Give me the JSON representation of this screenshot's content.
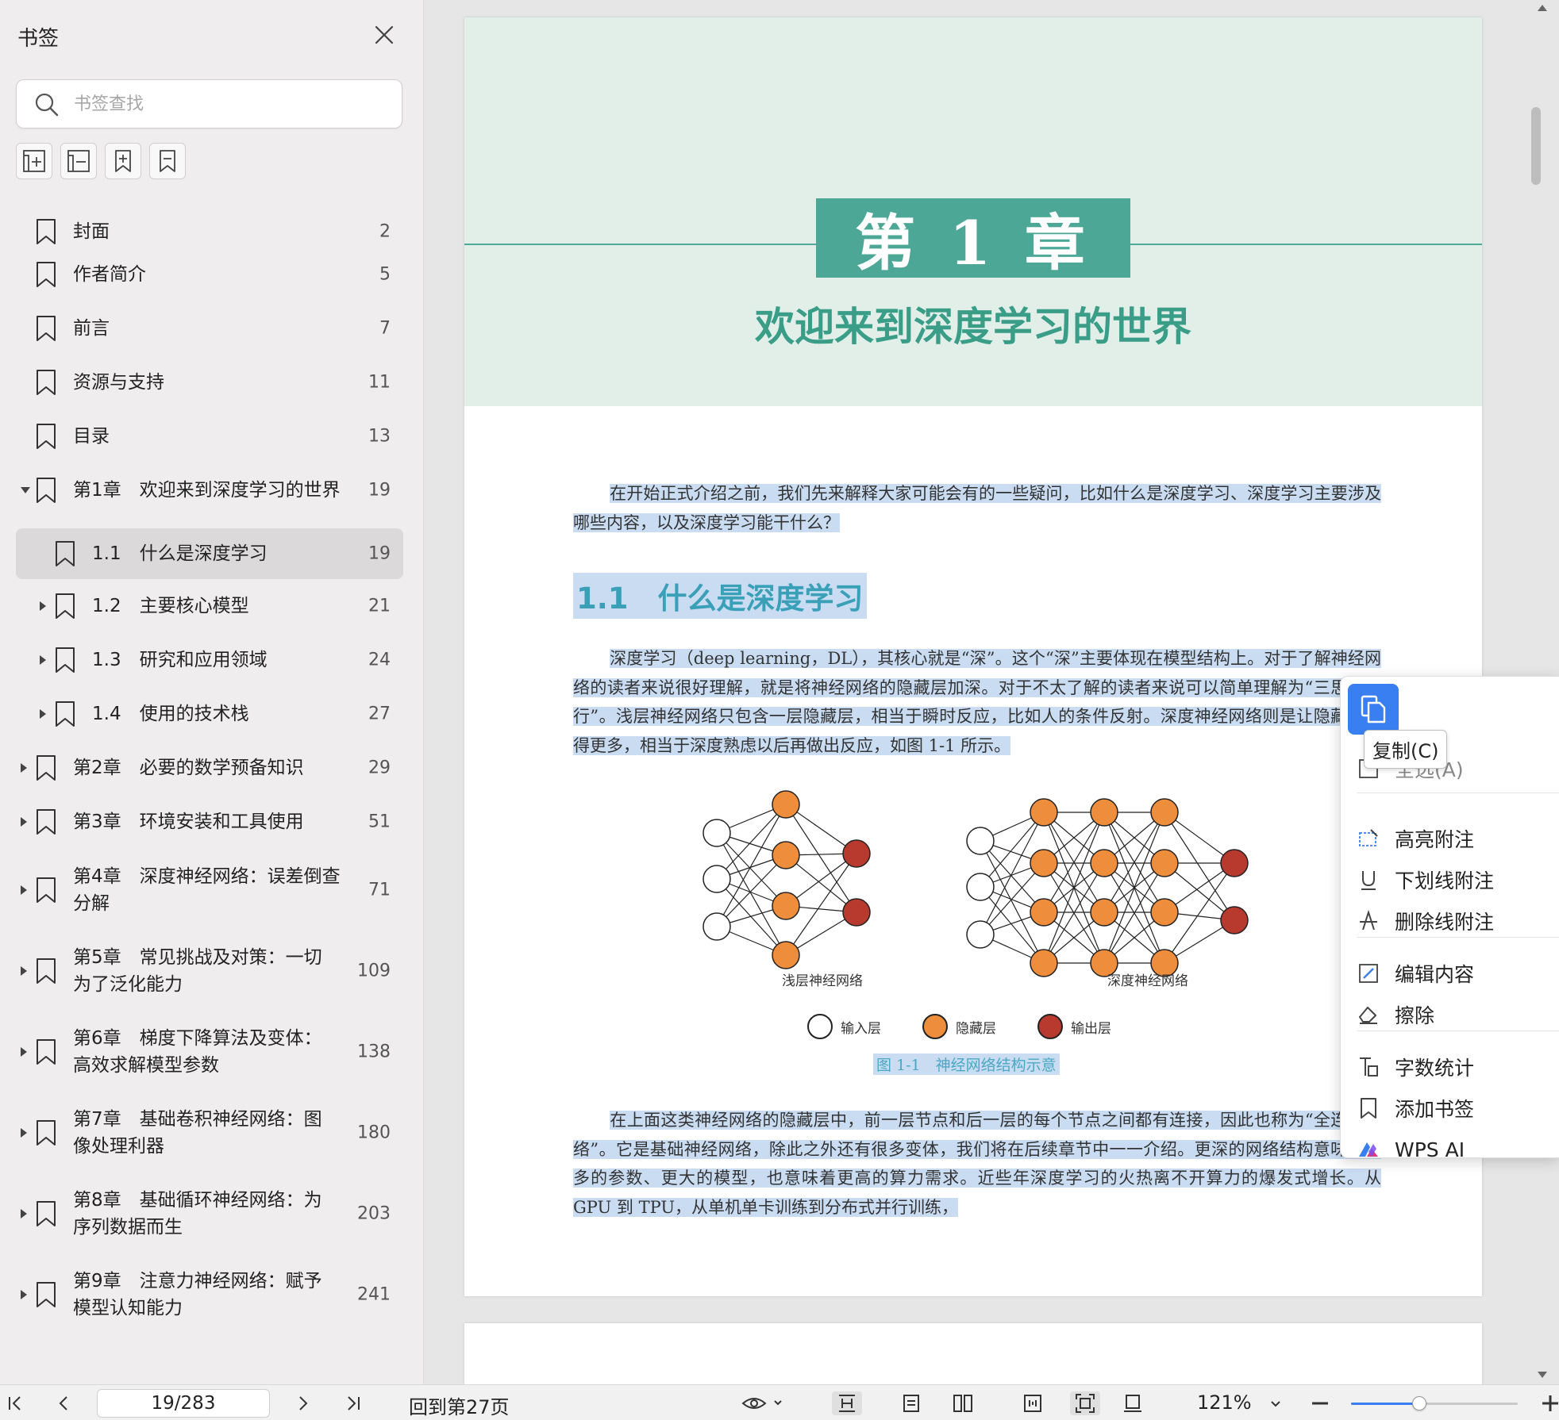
{
  "sidebar": {
    "title": "书签",
    "search_placeholder": "书签查找",
    "toolbar": [
      "expand-all",
      "collapse-all",
      "add-bookmark",
      "remove-bookmark"
    ],
    "items": [
      {
        "label": "封面",
        "page": "2"
      },
      {
        "label": "作者简介",
        "page": "5"
      },
      {
        "label": "前言",
        "page": "7"
      },
      {
        "label": "资源与支持",
        "page": "11"
      },
      {
        "label": "目录",
        "page": "13"
      },
      {
        "label": "第1章　欢迎来到深度学习的世界",
        "page": "19"
      },
      {
        "label": "1.1　什么是深度学习",
        "page": "19"
      },
      {
        "label": "1.2　主要核心模型",
        "page": "21"
      },
      {
        "label": "1.3　研究和应用领域",
        "page": "24"
      },
      {
        "label": "1.4　使用的技术栈",
        "page": "27"
      },
      {
        "label": "第2章　必要的数学预备知识",
        "page": "29"
      },
      {
        "label": "第3章　环境安装和工具使用",
        "page": "51"
      },
      {
        "label": "第4章　深度神经网络：误差倒查\n分解",
        "page": "71"
      },
      {
        "label": "第5章　常见挑战及对策：一切\n为了泛化能力",
        "page": "109"
      },
      {
        "label": "第6章　梯度下降算法及变体：\n高效求解模型参数",
        "page": "138"
      },
      {
        "label": "第7章　基础卷积神经网络：图\n像处理利器",
        "page": "180"
      },
      {
        "label": "第8章　基础循环神经网络：为\n序列数据而生",
        "page": "203"
      },
      {
        "label": "第9章　注意力神经网络：赋予\n模型认知能力",
        "page": "241"
      }
    ]
  },
  "document": {
    "chapter_label": "第 1 章",
    "chapter_title": "欢迎来到深度学习的世界",
    "intro_paragraph": "在开始正式介绍之前，我们先来解释大家可能会有的一些疑问，比如什么是深度学习、深度学习主要涉及哪些内容，以及深度学习能干什么？",
    "section_heading": "1.1　什么是深度学习",
    "paragraph_1": "深度学习（deep learning，DL），其核心就是“深”。这个“深”主要体现在模型结构上。对于了解神经网络的读者来说很好理解，就是将神经网络的隐藏层加深。对于不太了解的读者来说可以简单理解为“三思而后行”。浅层神经网络只包含一层隐藏层，相当于瞬时反应，比如人的条件反射。深度神经网络则是让隐藏层变得更多，相当于深度熟虑以后再做出反应，如图 1-1 所示。",
    "figure": {
      "shallow_caption": "浅层神经网络",
      "deep_caption": "深度神经网络",
      "legend_input": "输入层",
      "legend_hidden": "隐藏层",
      "legend_output": "输出层",
      "title": "图 1-1　神经网络结构示意"
    },
    "paragraph_2": "在上面这类神经网络的隐藏层中，前一层节点和后一层的每个节点之间都有连接，因此也称为“全连接网络”。它是基础神经网络，除此之外还有很多变体，我们将在后续章节中一一介绍。更深的网络结构意味着更多的参数、更大的模型，也意味着更高的算力需求。近些年深度学习的火热离不开算力的爆发式增长。从 GPU 到 TPU，从单机单卡训练到分布式并行训练，"
  },
  "context_menu": {
    "copy_tooltip": "复制(C)",
    "select_all_partial": "全选(A)",
    "items": [
      {
        "label": "高亮附注",
        "icon": "highlight-note-icon"
      },
      {
        "label": "下划线附注",
        "icon": "underline-icon"
      },
      {
        "label": "删除线附注",
        "icon": "strikethrough-icon"
      },
      {
        "label": "编辑内容",
        "icon": "edit-content-icon"
      },
      {
        "label": "擦除",
        "icon": "eraser-icon"
      },
      {
        "label": "字数统计",
        "icon": "word-count-icon"
      },
      {
        "label": "添加书签",
        "icon": "bookmark-icon"
      },
      {
        "label": "WPS AI",
        "icon": "wps-ai-icon"
      }
    ]
  },
  "status_bar": {
    "page_indicator": "19/283",
    "back_link": "回到第27页",
    "zoom": "121%",
    "zoom_slider_fraction": 0.41
  },
  "colors": {
    "chapter_green": "#4da796",
    "chapter_band": "#e2efe9",
    "selection": "#c9dcf2",
    "accent_blue": "#3a7ff2",
    "node_hidden": "#ee8d3b",
    "node_output": "#b83a2f"
  }
}
